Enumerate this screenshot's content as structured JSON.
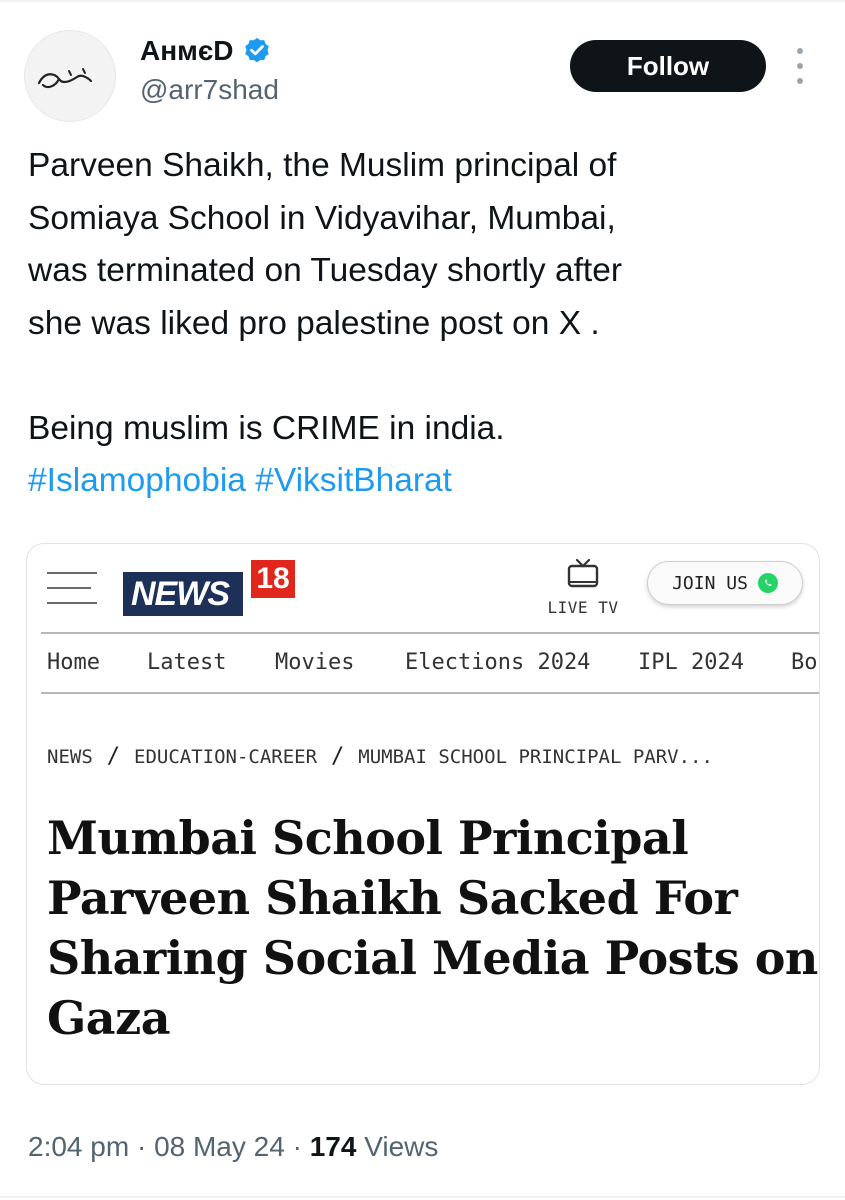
{
  "author": {
    "display_name": "AнмєD",
    "handle": "@arr7shad",
    "verified_icon": "verified-badge-icon",
    "avatar": "calligraphy-signature"
  },
  "actions": {
    "follow_label": "Follow",
    "more_icon": "more-vertical-icon"
  },
  "tweet": {
    "lines": [
      "Parveen Shaikh, the Muslim principal of",
      "Somiaya School in Vidyavihar, Mumbai,",
      "was terminated on Tuesday shortly after",
      "she was liked pro palestine post on X ."
    ],
    "line2": "Being muslim  is CRIME in india.",
    "hashtags": [
      "#Islamophobia",
      "#ViksitBharat"
    ]
  },
  "card": {
    "brand_word": "NEWS",
    "brand_num": "18",
    "live_tv_label": "LIVE TV",
    "join_label": "JOIN US",
    "nav": [
      "Home",
      "Latest",
      "Movies",
      "Elections 2024",
      "IPL 2024",
      "Bo"
    ],
    "breadcrumb": [
      "NEWS",
      "EDUCATION-CAREER",
      "MUMBAI SCHOOL PRINCIPAL PARV..."
    ],
    "headline_lines": [
      "Mumbai School Principal",
      "Parveen Shaikh Sacked For",
      "Sharing Social Media Posts on",
      "Gaza"
    ]
  },
  "meta": {
    "time": "2:04 pm",
    "date": "08 May 24",
    "views_count": "174",
    "views_label": "Views"
  },
  "colors": {
    "accent": "#1d9bf0",
    "follow_bg": "#0f1419",
    "muted": "#536471",
    "news18_blue": "#1c3058",
    "news18_red": "#e1261c"
  }
}
